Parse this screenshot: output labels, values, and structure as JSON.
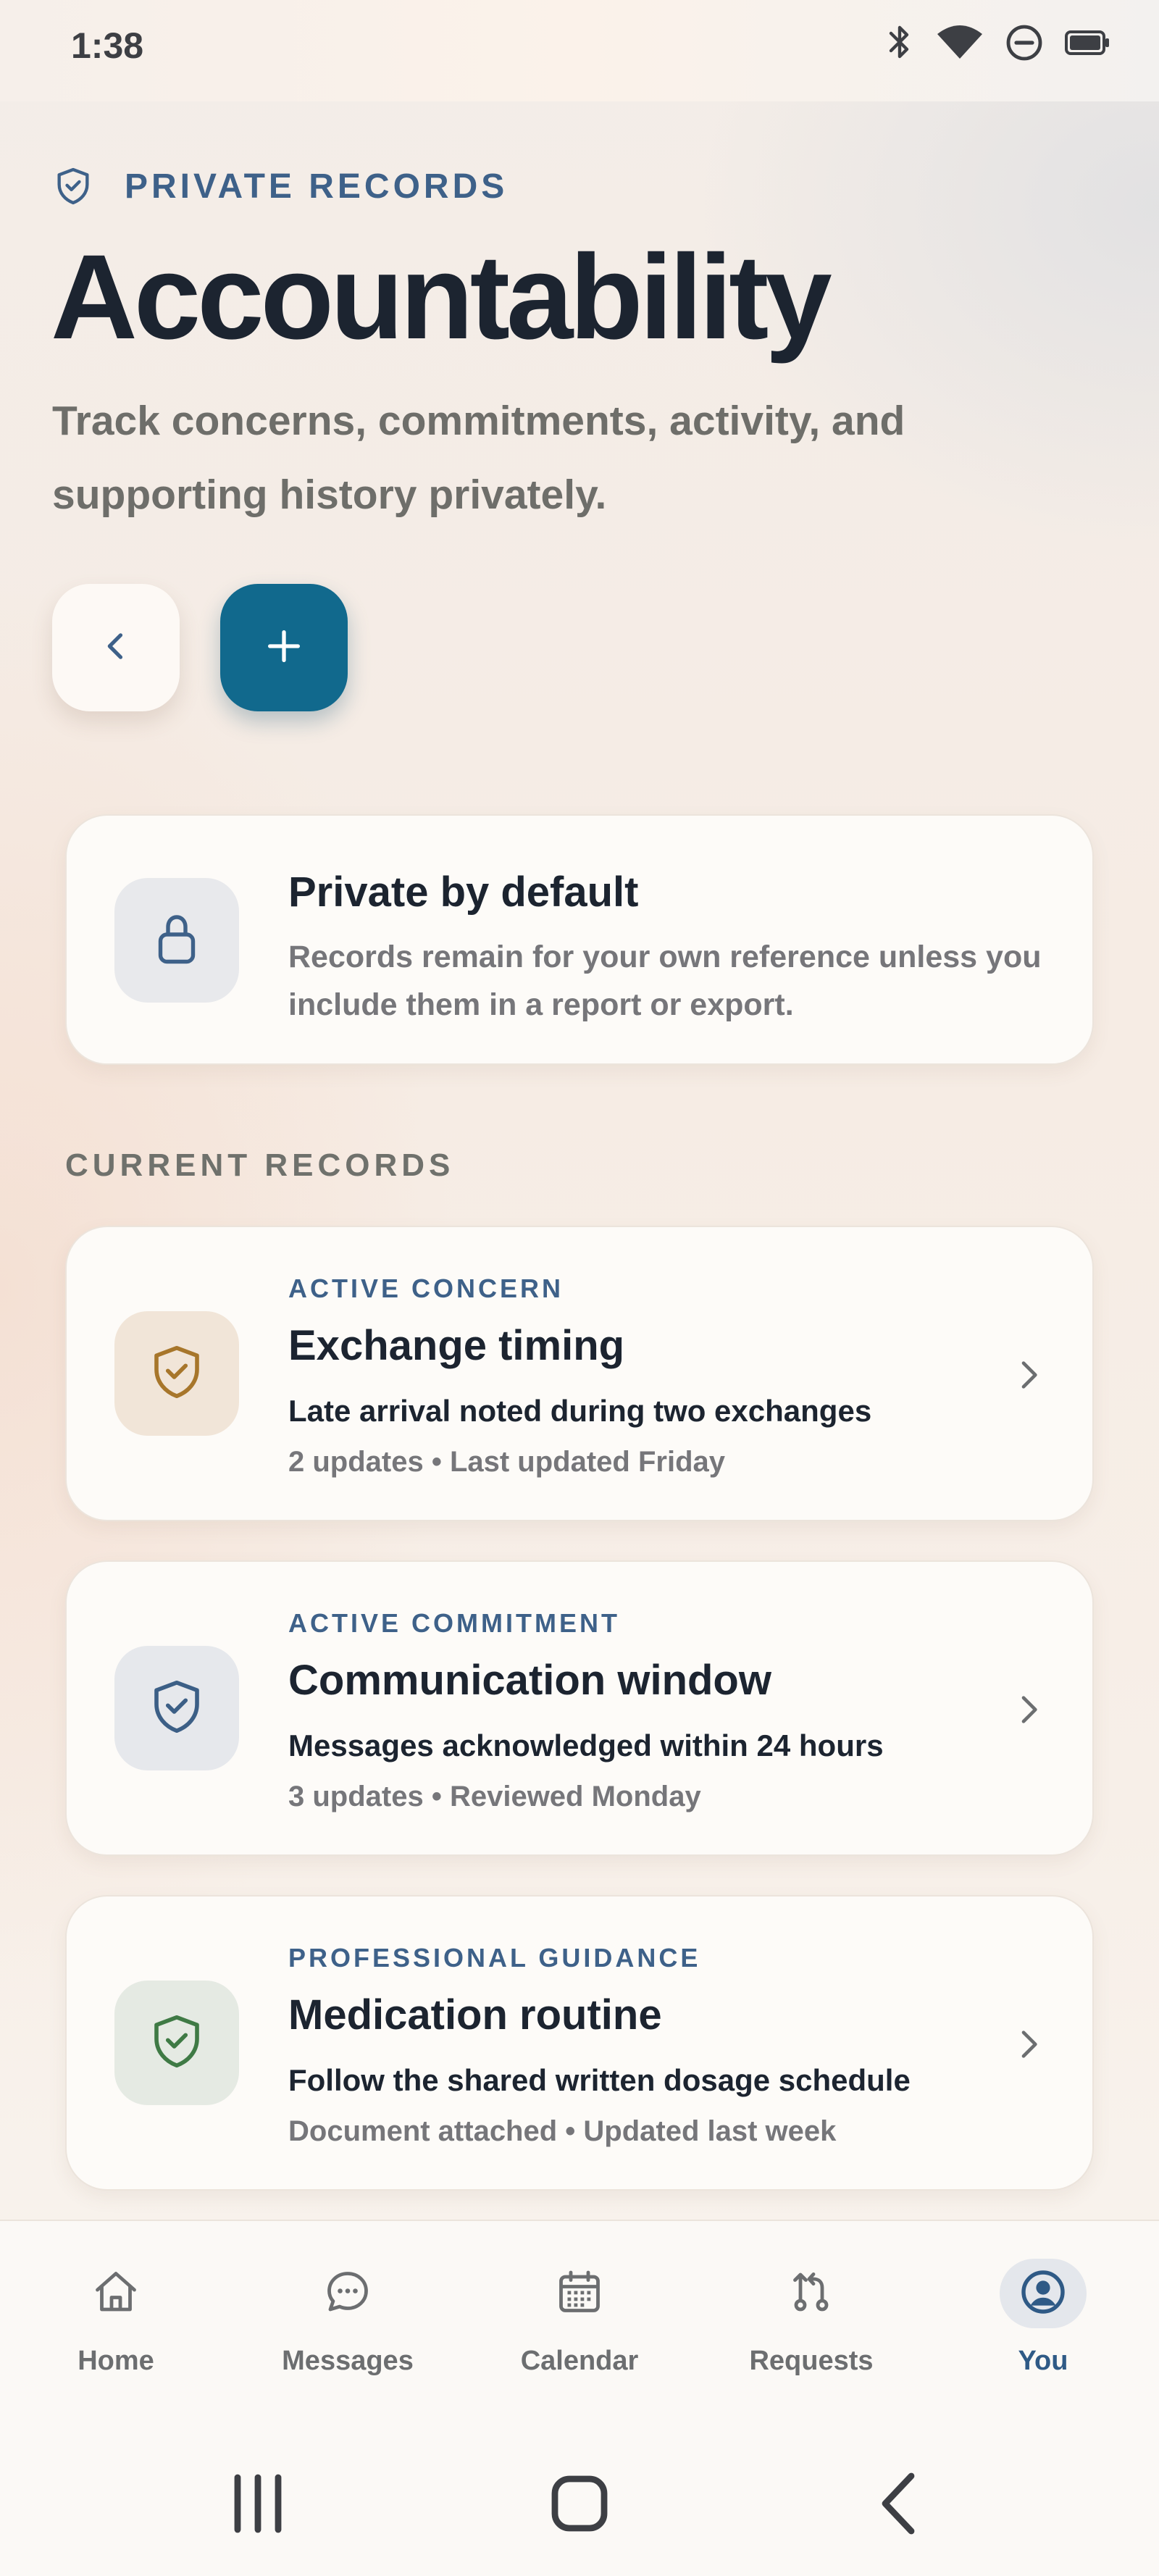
{
  "status_bar": {
    "time": "1:38",
    "icons": [
      "bluetooth-icon",
      "wifi-icon",
      "do-not-disturb-icon",
      "battery-icon"
    ]
  },
  "header": {
    "eyebrow_icon": "shield-icon",
    "eyebrow": "PRIVATE RECORDS",
    "title": "Accountability",
    "subtitle": "Track concerns, commitments, activity, and supporting history privately."
  },
  "actions": {
    "back_icon": "chevron-left-icon",
    "add_icon": "plus-icon"
  },
  "privacy_card": {
    "icon": "lock-icon",
    "title": "Private by default",
    "body": "Records remain for your own reference unless you include them in a report or export."
  },
  "records_section": {
    "label": "CURRENT RECORDS",
    "records": [
      {
        "type": "ACTIVE CONCERN",
        "title": "Exchange timing",
        "description": "Late arrival noted during two exchanges",
        "meta": "2 updates • Last updated Friday",
        "icon": "shield-check-icon",
        "icon_color": "#a7762b",
        "tile_color": "#f1e5d8"
      },
      {
        "type": "ACTIVE COMMITMENT",
        "title": "Communication window",
        "description": "Messages acknowledged within 24 hours",
        "meta": "3 updates • Reviewed Monday",
        "icon": "shield-check-icon",
        "icon_color": "#3c5f86",
        "tile_color": "#e6e8ec"
      },
      {
        "type": "PROFESSIONAL GUIDANCE",
        "title": "Medication routine",
        "description": "Follow the shared written dosage schedule",
        "meta": "Document attached • Updated last week",
        "icon": "shield-check-icon",
        "icon_color": "#3f7a45",
        "tile_color": "#e5eae3"
      }
    ]
  },
  "bottom_nav": {
    "items": [
      {
        "label": "Home",
        "icon": "home-icon",
        "active": false
      },
      {
        "label": "Messages",
        "icon": "chat-bubble-icon",
        "active": false
      },
      {
        "label": "Calendar",
        "icon": "calendar-icon",
        "active": false
      },
      {
        "label": "Requests",
        "icon": "requests-icon",
        "active": false
      },
      {
        "label": "You",
        "icon": "profile-icon",
        "active": true
      }
    ]
  },
  "system_nav": {
    "icons": [
      "recent-apps-icon",
      "home-button-icon",
      "back-icon"
    ]
  },
  "colors": {
    "accent": "#11698d",
    "heading": "#1c2430",
    "eyebrow": "#3e6189",
    "muted": "#76767a"
  }
}
